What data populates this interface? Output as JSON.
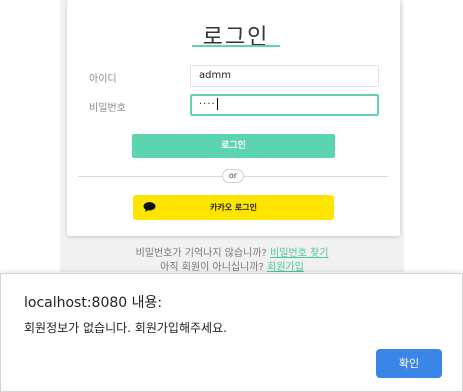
{
  "login": {
    "title": "로그인",
    "id_label": "아이디",
    "id_value": "admm",
    "pw_label": "비밀번호",
    "pw_masked": "····",
    "login_button": "로그인",
    "or_label": "or",
    "kakao_button": "카카오 로그인"
  },
  "help": {
    "forgot_text": "비밀번호가 기억나지 않습니까?",
    "forgot_link": "비밀번호 찾기",
    "signup_text": "아직 회원이 아니십니까?",
    "signup_link": "회원가입"
  },
  "dialog": {
    "title": "localhost:8080 내용:",
    "message": "회원정보가 없습니다. 회원가입해주세요.",
    "ok_button": "확인"
  },
  "colors": {
    "accent": "#5cd4b0",
    "kakao": "#fee500",
    "dialog_button": "#3a86e8"
  }
}
